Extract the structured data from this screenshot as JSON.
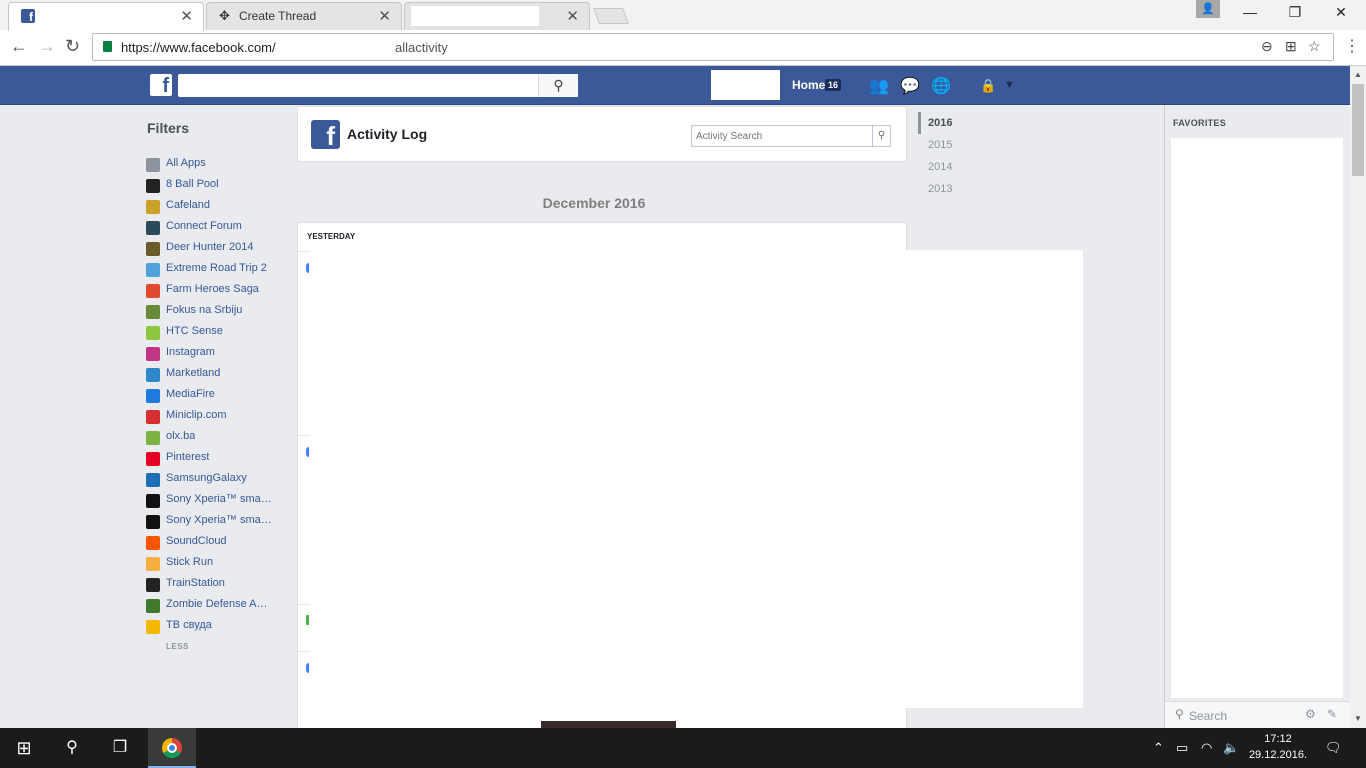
{
  "browser": {
    "tabs": [
      {
        "title": "",
        "active": true
      },
      {
        "title": "Create Thread",
        "active": false
      },
      {
        "title": "",
        "active": false
      }
    ],
    "url": "https://www.facebook.com/",
    "url_suffix": "allactivity",
    "tab_close_glyph": "✕"
  },
  "facebook": {
    "home_label": "Home",
    "home_count": "16"
  },
  "filters": {
    "title": "Filters",
    "items": [
      {
        "label": "All Apps",
        "color": "#8d949e"
      },
      {
        "label": "8 Ball Pool",
        "color": "#222222"
      },
      {
        "label": "Cafeland",
        "color": "#c9a227"
      },
      {
        "label": "Connect Forum",
        "color": "#2b4a5a"
      },
      {
        "label": "Deer Hunter 2014",
        "color": "#6b5a2a"
      },
      {
        "label": "Extreme Road Trip 2",
        "color": "#4fa3d8"
      },
      {
        "label": "Farm Heroes Saga",
        "color": "#e04a2f"
      },
      {
        "label": "Fokus na Srbiju",
        "color": "#6a8a3a"
      },
      {
        "label": "HTC Sense",
        "color": "#8dc63f"
      },
      {
        "label": "Instagram",
        "color": "#c13584"
      },
      {
        "label": "Marketland",
        "color": "#2d88c8"
      },
      {
        "label": "MediaFire",
        "color": "#1f7ae0"
      },
      {
        "label": "Miniclip.com",
        "color": "#d62f2f"
      },
      {
        "label": "olx.ba",
        "color": "#7cb342"
      },
      {
        "label": "Pinterest",
        "color": "#e60023"
      },
      {
        "label": "SamsungGalaxy",
        "color": "#1e6fb8"
      },
      {
        "label": "Sony Xperia™ sma…",
        "color": "#111111"
      },
      {
        "label": "Sony Xperia™ sma…",
        "color": "#111111"
      },
      {
        "label": "SoundCloud",
        "color": "#ff5500"
      },
      {
        "label": "Stick Run",
        "color": "#f5b041"
      },
      {
        "label": "TrainStation",
        "color": "#222222"
      },
      {
        "label": "Zombie Defense A…",
        "color": "#3f7a2c"
      },
      {
        "label": "ТВ свуда",
        "color": "#f5b800"
      }
    ],
    "less_label": "LESS"
  },
  "activity": {
    "title": "Activity Log",
    "search_placeholder": "Activity Search",
    "month": "December 2016",
    "section_label": "YESTERDAY"
  },
  "years": [
    "2016",
    "2015",
    "2014",
    "2013"
  ],
  "sidebar": {
    "favorites_title": "FAVORITES",
    "chat_search_placeholder": "Search"
  },
  "taskbar": {
    "time": "17:12",
    "date": "29.12.2016."
  }
}
